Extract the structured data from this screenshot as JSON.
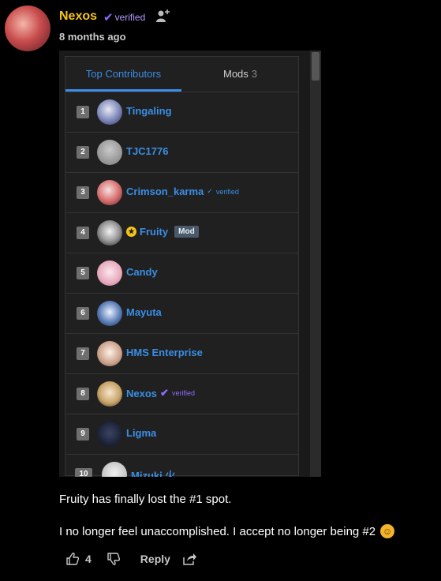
{
  "post": {
    "username": "Nexos",
    "verified_label": "verified",
    "time": "8 months ago"
  },
  "embed": {
    "tabs": [
      {
        "label": "Top Contributors"
      },
      {
        "label": "Mods",
        "count": "3"
      }
    ],
    "contributors": [
      {
        "rank": "1",
        "name": "Tingaling"
      },
      {
        "rank": "2",
        "name": "TJC1776"
      },
      {
        "rank": "3",
        "name": "Crimson_karma",
        "verified": "verified"
      },
      {
        "rank": "4",
        "name": "Fruity",
        "badge": "Mod"
      },
      {
        "rank": "5",
        "name": "Candy"
      },
      {
        "rank": "6",
        "name": "Mayuta"
      },
      {
        "rank": "7",
        "name": "HMS Enterprise"
      },
      {
        "rank": "8",
        "name": "Nexos",
        "verified": "verified"
      },
      {
        "rank": "9",
        "name": "Ligma"
      },
      {
        "rank": "10",
        "name": "Mizuki 火"
      }
    ]
  },
  "comment": {
    "line1": "Fruity has finally lost the #1 spot.",
    "line2": "I no longer feel unaccomplished. I accept no longer being #2"
  },
  "actions": {
    "like_count": "4",
    "reply_label": "Reply"
  }
}
